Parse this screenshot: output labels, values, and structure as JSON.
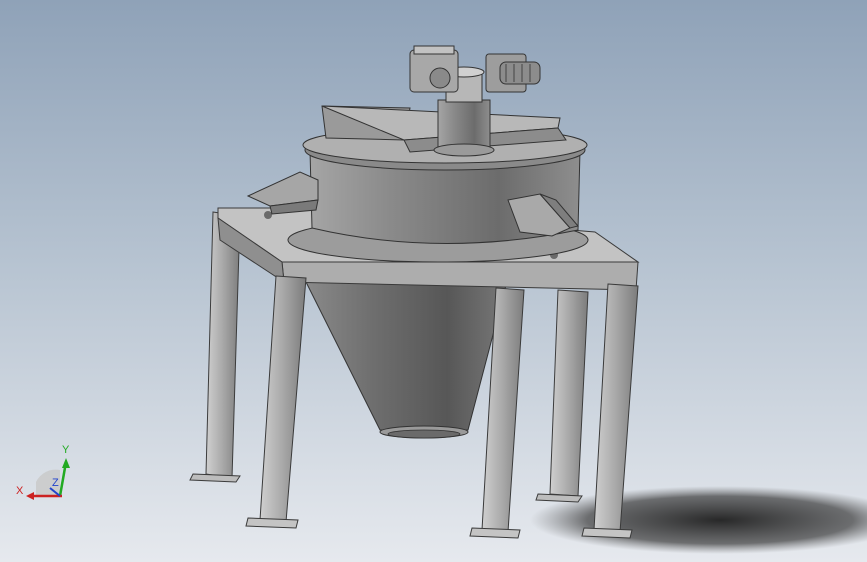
{
  "colors": {
    "background_top": "#8fa2b8",
    "background_bottom": "#e6e9ee",
    "steel_light": "#b9b9b9",
    "steel_dark": "#5f5f5f",
    "axis_x": "#cc2222",
    "axis_y": "#22aa22",
    "axis_z": "#2244cc"
  },
  "triad": {
    "x_label": "X",
    "y_label": "Y",
    "z_label": "Z"
  }
}
